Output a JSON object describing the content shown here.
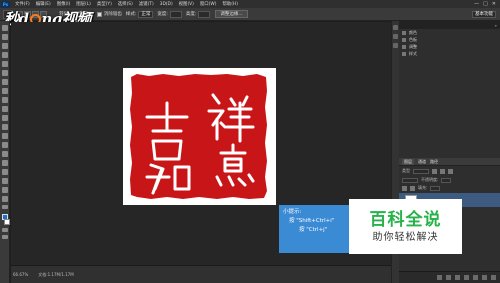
{
  "app": {
    "logo_text": "Ps"
  },
  "watermark": {
    "left_text": "秒d",
    "right_text": "ng视频"
  },
  "menubar": {
    "items": [
      "文件(F)",
      "编辑(E)",
      "图像(I)",
      "图层(L)",
      "类型(Y)",
      "选择(S)",
      "滤镜(T)",
      "3D(D)",
      "视图(V)",
      "窗口(W)",
      "帮助(H)"
    ],
    "controls": [
      "—",
      "□",
      "✕"
    ]
  },
  "options_bar": {
    "feather_label": "羽化:",
    "feather_value": "0 像素",
    "antialias_label": "消除锯齿",
    "style_label": "样式:",
    "style_value": "正常",
    "width_label": "宽度:",
    "width_value": "",
    "height_label": "高度:",
    "refine_button": "调整边缘...",
    "workspace_value": "基本功能"
  },
  "document": {
    "seal_chars": [
      "祥",
      "吉",
      "如",
      "意"
    ],
    "seal_color": "#c81618"
  },
  "statusbar": {
    "zoom": "66.67%",
    "doc_info": "文档:1.17M/1.17M"
  },
  "panels": {
    "rows": [
      "颜色",
      "色板",
      "调整",
      "样式"
    ],
    "layers_tabs": [
      "图层",
      "通道",
      "路径"
    ],
    "kind_label": "类型",
    "opacity_label": "不透明度:",
    "fill_label": "填充:"
  },
  "tip": {
    "title": "小提示:",
    "line1": "按 \"Shift+Ctrl+i\"",
    "line2": "按 \"Ctrl+j\""
  },
  "baike": {
    "title": "百科全说",
    "subtitle": "助你轻松解决"
  },
  "colors": {
    "foreground": "#1f6fd6",
    "background": "#ffffff",
    "tip_bg": "#3b8ad4",
    "baike_green": "#27b24a"
  }
}
